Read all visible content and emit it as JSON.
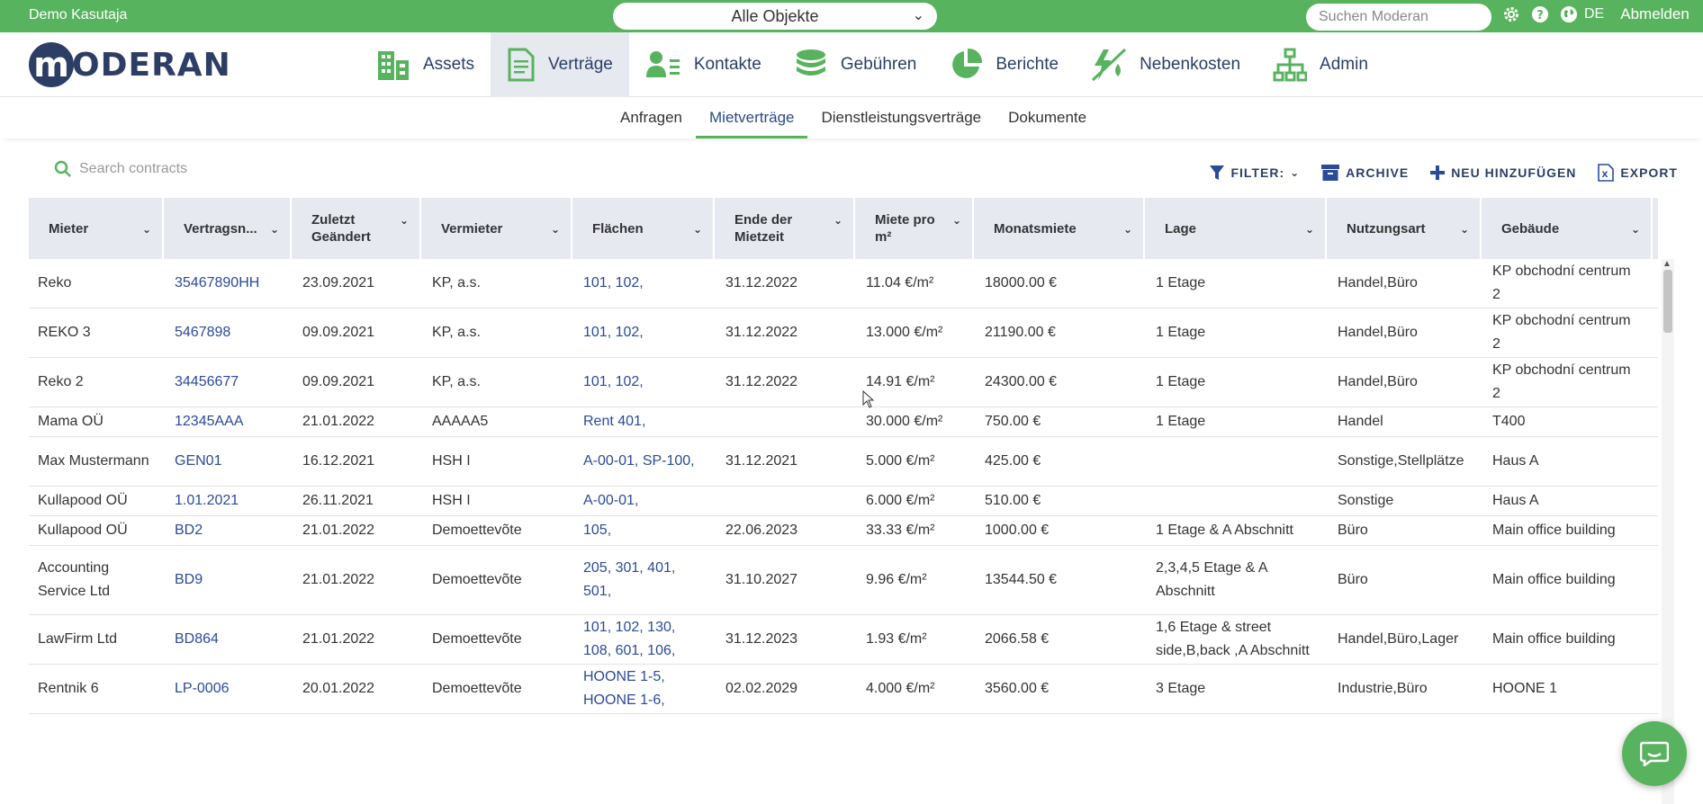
{
  "topbar": {
    "user": "Demo Kasutaja",
    "object_select": "Alle Objekte",
    "search_placeholder": "Suchen Moderan",
    "language": "DE",
    "logout": "Abmelden"
  },
  "logo": {
    "letter": "m",
    "word": "ODERAN"
  },
  "nav": {
    "items": [
      {
        "label": "Assets",
        "icon": "buildings-icon"
      },
      {
        "label": "Verträge",
        "icon": "document-icon"
      },
      {
        "label": "Kontakte",
        "icon": "contact-card-icon"
      },
      {
        "label": "Gebühren",
        "icon": "coins-icon"
      },
      {
        "label": "Berichte",
        "icon": "pie-chart-icon"
      },
      {
        "label": "Nebenkosten",
        "icon": "utilities-icon"
      },
      {
        "label": "Admin",
        "icon": "org-chart-icon"
      }
    ],
    "active": "Verträge"
  },
  "subnav": {
    "tabs": [
      "Anfragen",
      "Mietverträge",
      "Dienstleistungsverträge",
      "Dokumente"
    ],
    "active": "Mietverträge"
  },
  "toolbar": {
    "search_placeholder": "Search contracts",
    "filter": "FILTER:",
    "archive": "ARCHIVE",
    "add_new": "NEU HINZUFÜGEN",
    "export": "EXPORT"
  },
  "table": {
    "columns": [
      "Mieter",
      "Vertragsn...",
      "Zuletzt Geändert",
      "Vermieter",
      "Flächen",
      "Ende der Mietzeit",
      "Miete pro m²",
      "Monatsmiete",
      "Lage",
      "Nutzungsart",
      "Gebäude"
    ],
    "rows": [
      [
        "Reko",
        "35467890HH",
        "23.09.2021",
        "KP, a.s.",
        "101, 102,",
        "31.12.2022",
        "11.04 €/m²",
        "18000.00 €",
        "1 Etage",
        "Handel,Büro",
        "KP obchodní centrum 2"
      ],
      [
        "REKO 3",
        "5467898",
        "09.09.2021",
        "KP, a.s.",
        "101, 102,",
        "31.12.2022",
        "13.000 €/m²",
        "21190.00 €",
        "1 Etage",
        "Handel,Büro",
        "KP obchodní centrum 2"
      ],
      [
        "Reko 2",
        "34456677",
        "09.09.2021",
        "KP, a.s.",
        "101, 102,",
        "31.12.2022",
        "14.91 €/m²",
        "24300.00 €",
        "1 Etage",
        "Handel,Büro",
        "KP obchodní centrum 2"
      ],
      [
        "Mama OÜ",
        "12345AAA",
        "21.01.2022",
        "AAAAA5",
        "Rent 401,",
        "",
        "30.000 €/m²",
        "750.00 €",
        "1 Etage",
        "Handel",
        "T400"
      ],
      [
        "Max Mustermann",
        "GEN01",
        "16.12.2021",
        "HSH I",
        "A-00-01, SP-100,",
        "31.12.2021",
        "5.000 €/m²",
        "425.00 €",
        "",
        "Sonstige,Stellplätze",
        "Haus A"
      ],
      [
        "Kullapood OÜ",
        "1.01.2021",
        "26.11.2021",
        "HSH I",
        "A-00-01,",
        "",
        "6.000 €/m²",
        "510.00 €",
        "",
        "Sonstige",
        "Haus A"
      ],
      [
        "Kullapood OÜ",
        "BD2",
        "21.01.2022",
        "Demoettevõte",
        "105,",
        "22.06.2023",
        "33.33 €/m²",
        "1000.00 €",
        "1 Etage & A Abschnitt",
        "Büro",
        "Main office building"
      ],
      [
        "Accounting Service Ltd",
        "BD9",
        "21.01.2022",
        "Demoettevõte",
        "205, 301, 401, 501,",
        "31.10.2027",
        "9.96 €/m²",
        "13544.50 €",
        "2,3,4,5 Etage & A Abschnitt",
        "Büro",
        "Main office building"
      ],
      [
        "LawFirm Ltd",
        "BD864",
        "21.01.2022",
        "Demoettevõte",
        "101, 102, 130, 108, 601, 106,",
        "31.12.2023",
        "1.93 €/m²",
        "2066.58 €",
        "1,6 Etage & street side,B,back ,A Abschnitt",
        "Handel,Büro,Lager",
        "Main office building"
      ],
      [
        "Rentnik 6",
        "LP-0006",
        "20.01.2022",
        "Demoettevõte",
        "HOONE 1-5, HOONE 1-6,",
        "02.02.2029",
        "4.000 €/m²",
        "3560.00 €",
        "3 Etage",
        "Industrie,Büro",
        "HOONE 1"
      ]
    ]
  },
  "colors": {
    "accent_green": "#58b35e",
    "brand_navy": "#2c3e66",
    "link_blue": "#2a4a9a",
    "header_bg": "#e6eaf0"
  }
}
